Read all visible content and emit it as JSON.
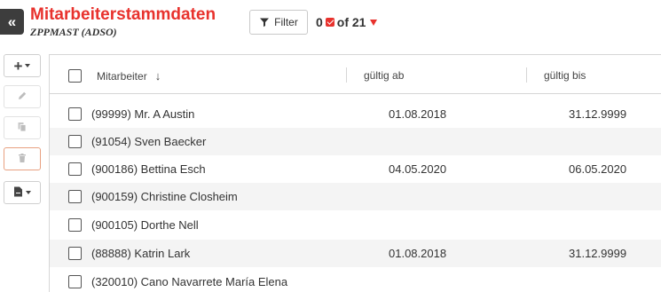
{
  "header": {
    "back_label": "«",
    "title": "Mitarbeiterstammdaten",
    "subtitle": "ZPPMAST (ADSO)",
    "filter_label": "Filter",
    "count_prefix": "0",
    "count_suffix": "of 21"
  },
  "toolbar": {
    "items": [
      {
        "name": "add-menu-button",
        "icon": "plus-icon",
        "enabled": true
      },
      {
        "name": "edit-button",
        "icon": "pencil-icon",
        "enabled": false
      },
      {
        "name": "copy-button",
        "icon": "copy-icon",
        "enabled": false
      },
      {
        "name": "delete-button",
        "icon": "trash-icon",
        "enabled": false
      },
      {
        "name": "export-menu-button",
        "icon": "file-icon",
        "enabled": true
      }
    ]
  },
  "table": {
    "columns": [
      "Mitarbeiter",
      "gültig ab",
      "gültig bis"
    ],
    "sort_column": "Mitarbeiter",
    "sort_direction": "descending",
    "rows": [
      {
        "mitarbeiter": "(99999) Mr. A Austin",
        "gueltig_ab": "01.08.2018",
        "gueltig_bis": "31.12.9999"
      },
      {
        "mitarbeiter": "(91054) Sven Baecker",
        "gueltig_ab": "",
        "gueltig_bis": ""
      },
      {
        "mitarbeiter": "(900186) Bettina Esch",
        "gueltig_ab": "04.05.2020",
        "gueltig_bis": "06.05.2020"
      },
      {
        "mitarbeiter": "(900159) Christine Closheim",
        "gueltig_ab": "",
        "gueltig_bis": ""
      },
      {
        "mitarbeiter": "(900105) Dorthe Nell",
        "gueltig_ab": "",
        "gueltig_bis": ""
      },
      {
        "mitarbeiter": "(88888) Katrin Lark",
        "gueltig_ab": "01.08.2018",
        "gueltig_bis": "31.12.9999"
      },
      {
        "mitarbeiter": "(320010) Cano Navarrete María Elena",
        "gueltig_ab": "",
        "gueltig_bis": ""
      }
    ]
  },
  "colors": {
    "accent": "#e8322d",
    "back_button": "#3d3d3d",
    "row_alt": "#f4f4f4"
  }
}
